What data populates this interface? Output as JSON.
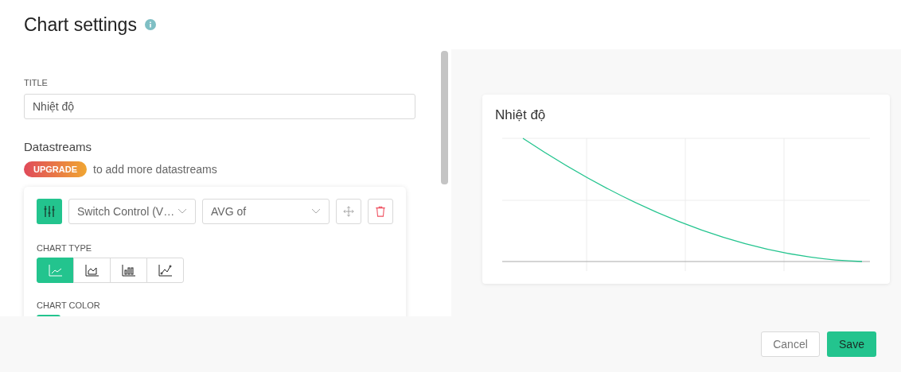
{
  "window": {
    "title": "Chart settings"
  },
  "title_field": {
    "label": "TITLE",
    "value": "Nhiệt độ"
  },
  "datastreams": {
    "heading": "Datastreams",
    "upgrade_badge": "UPGRADE",
    "upgrade_text": "to add more datastreams",
    "datastream": {
      "source": "Switch Control (V…",
      "aggregation": "AVG of",
      "chart_type_label": "CHART TYPE",
      "chart_types": [
        {
          "kind": "line",
          "selected": true
        },
        {
          "kind": "area",
          "selected": false
        },
        {
          "kind": "bar",
          "selected": false
        },
        {
          "kind": "points",
          "selected": false
        }
      ],
      "chart_color_label": "CHART COLOR",
      "color": "#23c48e"
    }
  },
  "preview": {
    "title": "Nhiệt độ"
  },
  "buttons": {
    "cancel": "Cancel",
    "save": "Save"
  }
}
